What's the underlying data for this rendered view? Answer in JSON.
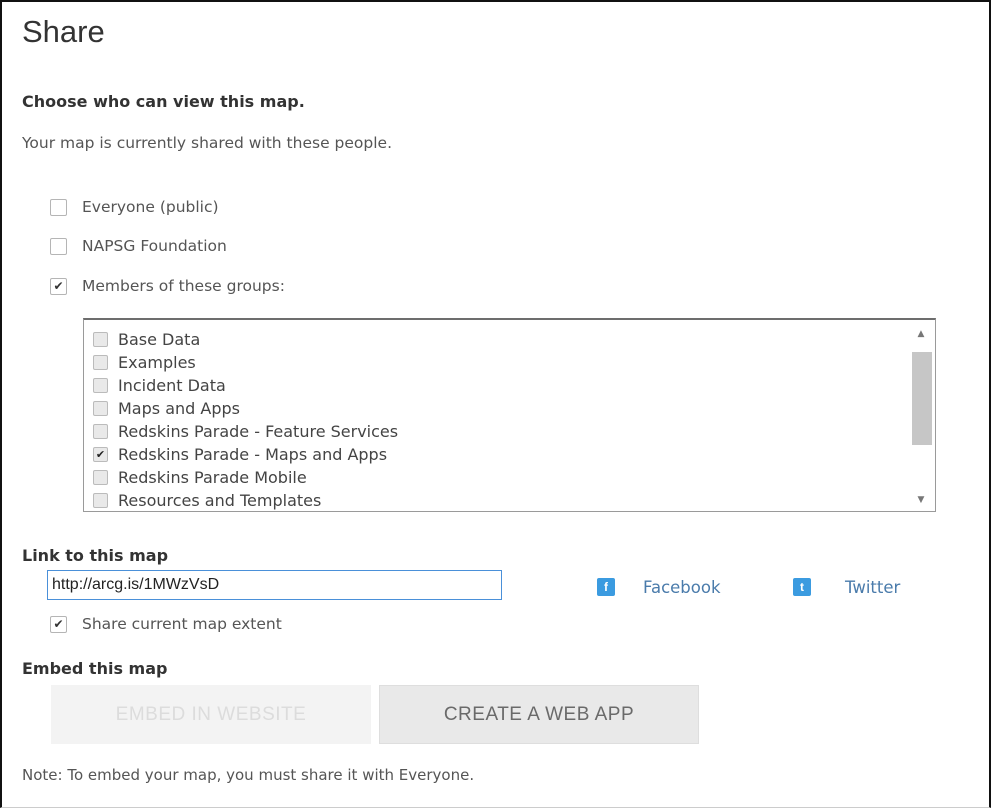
{
  "title": "Share",
  "heading": "Choose who can view this map.",
  "subtext": "Your map is currently shared with these people.",
  "options": [
    {
      "label": "Everyone (public)",
      "checked": false
    },
    {
      "label": "NAPSG Foundation",
      "checked": false
    },
    {
      "label": "Members of these groups:",
      "checked": true
    }
  ],
  "groups": [
    {
      "label": "Base Data",
      "checked": false
    },
    {
      "label": "Examples",
      "checked": false
    },
    {
      "label": "Incident Data",
      "checked": false
    },
    {
      "label": "Maps and Apps",
      "checked": false
    },
    {
      "label": "Redskins Parade - Feature Services",
      "checked": false
    },
    {
      "label": "Redskins Parade - Maps and Apps",
      "checked": true
    },
    {
      "label": "Redskins Parade Mobile",
      "checked": false
    },
    {
      "label": "Resources and Templates",
      "checked": false
    }
  ],
  "link": {
    "heading": "Link to this map",
    "url": "http://arcg.is/1MWzVsD",
    "share_extent_label": "Share current map extent",
    "share_extent_checked": true,
    "facebook_label": "Facebook",
    "twitter_label": "Twitter"
  },
  "embed": {
    "heading": "Embed this map",
    "embed_button": "EMBED IN WEBSITE",
    "create_button": "CREATE A WEB APP",
    "note": "Note: To embed your map, you must share it with Everyone."
  }
}
